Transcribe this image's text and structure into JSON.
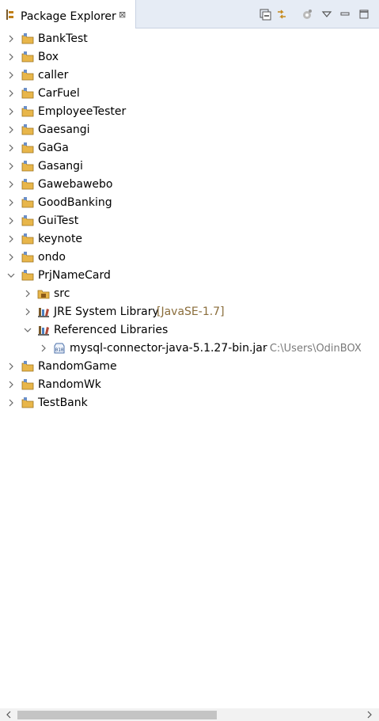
{
  "view": {
    "title": "Package Explorer",
    "close_glyph": "⊠"
  },
  "toolbar": {
    "buttons": [
      "collapse-all-icon",
      "link-with-editor-icon",
      "view-settings-icon",
      "view-menu-icon",
      "minimize-icon",
      "maximize-icon"
    ]
  },
  "tree": {
    "items": [
      {
        "label": "BankTest",
        "expanded": false
      },
      {
        "label": "Box",
        "expanded": false
      },
      {
        "label": "caller",
        "expanded": false
      },
      {
        "label": "CarFuel",
        "expanded": false
      },
      {
        "label": "EmployeeTester",
        "expanded": false
      },
      {
        "label": "Gaesangi",
        "expanded": false
      },
      {
        "label": "GaGa",
        "expanded": false
      },
      {
        "label": "Gasangi",
        "expanded": false
      },
      {
        "label": "Gawebawebo",
        "expanded": false
      },
      {
        "label": "GoodBanking",
        "expanded": false
      },
      {
        "label": "GuiTest",
        "expanded": false
      },
      {
        "label": "keynote",
        "expanded": false
      },
      {
        "label": "ondo",
        "expanded": false
      },
      {
        "label": "PrjNameCard",
        "expanded": true
      },
      {
        "label": "src",
        "expanded": false
      },
      {
        "label": "JRE System Library",
        "suffix": "[JavaSE-1.7]",
        "expanded": false
      },
      {
        "label": "Referenced Libraries",
        "expanded": true
      },
      {
        "label": "mysql-connector-java-5.1.27-bin.jar",
        "suffix": "- C:\\Users\\OdinBOX",
        "expanded": false
      },
      {
        "label": "RandomGame",
        "expanded": false
      },
      {
        "label": "RandomWk",
        "expanded": false
      },
      {
        "label": "TestBank",
        "expanded": false
      }
    ]
  },
  "colors": {
    "tab_bar": "#e6ecf5",
    "project_folder": "#e8b64a",
    "library_suffix": "#8a6d3b",
    "decoration": "#7a7a7a"
  }
}
